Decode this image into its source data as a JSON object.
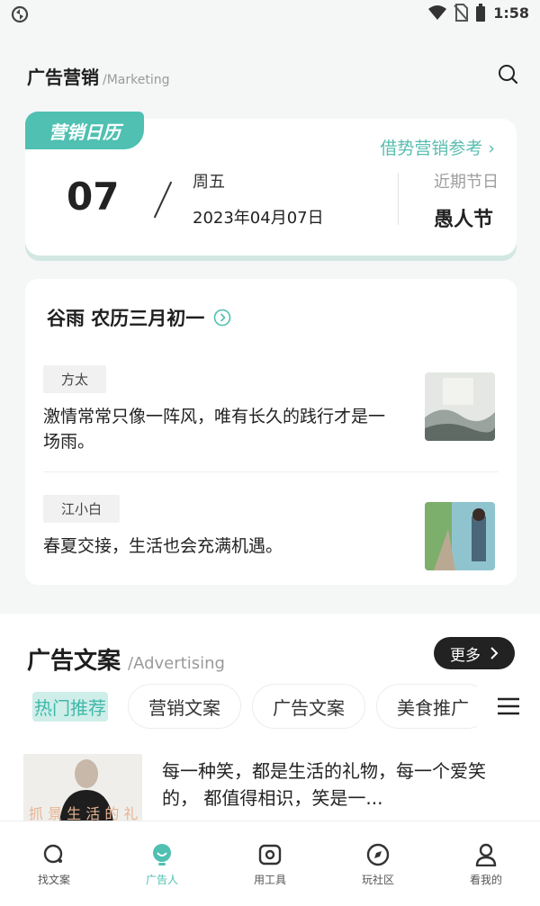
{
  "status_bar": {
    "time": "1:58"
  },
  "header": {
    "title": "广告营销",
    "subtitle": "/Marketing"
  },
  "calendar": {
    "tag": "营销日历",
    "reference_link": "借势营销参考 ›",
    "day": "07",
    "weekday": "周五",
    "date": "2023年04月07日",
    "festival_label": "近期节日",
    "festival": "愚人节"
  },
  "quotes": {
    "title": "谷雨 农历三月初一",
    "items": [
      {
        "author": "方太",
        "text": "激情常常只像一阵风，唯有长久的践行才是一场雨。"
      },
      {
        "author": "江小白",
        "text": "春夏交接，生活也会充满机遇。"
      }
    ]
  },
  "advertising": {
    "title": "广告文案",
    "subtitle": "/Advertising",
    "more_label": "更多",
    "tabs": [
      "热门推荐",
      "营销文案",
      "广告文案",
      "美食推广"
    ],
    "article": {
      "text": "每一种笑，都是生活的礼物，每一个爱笑的， 都值得相识，笑是一...",
      "image_caption": "抓 景 生 活 的 礼"
    }
  },
  "nav": {
    "items": [
      {
        "label": "找文案",
        "icon": "find-copy-icon"
      },
      {
        "label": "广告人",
        "icon": "ad-person-icon"
      },
      {
        "label": "用工具",
        "icon": "tools-icon"
      },
      {
        "label": "玩社区",
        "icon": "community-icon"
      },
      {
        "label": "看我的",
        "icon": "profile-icon"
      }
    ],
    "active_index": 1
  },
  "colors": {
    "accent": "#4fc0b2",
    "dark": "#222222"
  }
}
